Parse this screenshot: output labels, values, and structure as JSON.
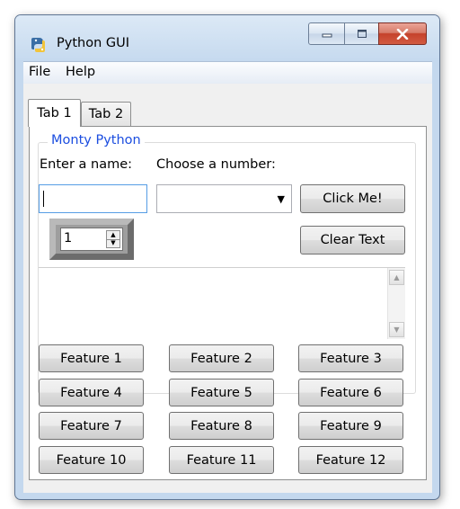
{
  "window": {
    "title": "Python GUI",
    "controls": {
      "minimize_icon": "minimize-icon",
      "maximize_icon": "maximize-icon",
      "close_icon": "close-icon"
    },
    "accent_close": "#c5412b"
  },
  "menubar": {
    "items": [
      "File",
      "Help"
    ]
  },
  "tabs": [
    {
      "label": "Tab 1",
      "selected": true
    },
    {
      "label": "Tab 2",
      "selected": false
    }
  ],
  "frame": {
    "title": "Monty Python",
    "title_color": "#1c4ee0",
    "name_label": "Enter a name:",
    "number_label": "Choose a number:",
    "name_value": "",
    "combo_value": "",
    "click_button": "Click Me!",
    "clear_button": "Clear Text",
    "spinbox_value": "1",
    "scrolled_text": ""
  },
  "features": [
    "Feature 1",
    "Feature 2",
    "Feature 3",
    "Feature 4",
    "Feature 5",
    "Feature 6",
    "Feature 7",
    "Feature 8",
    "Feature 9",
    "Feature 10",
    "Feature 11",
    "Feature 12"
  ]
}
